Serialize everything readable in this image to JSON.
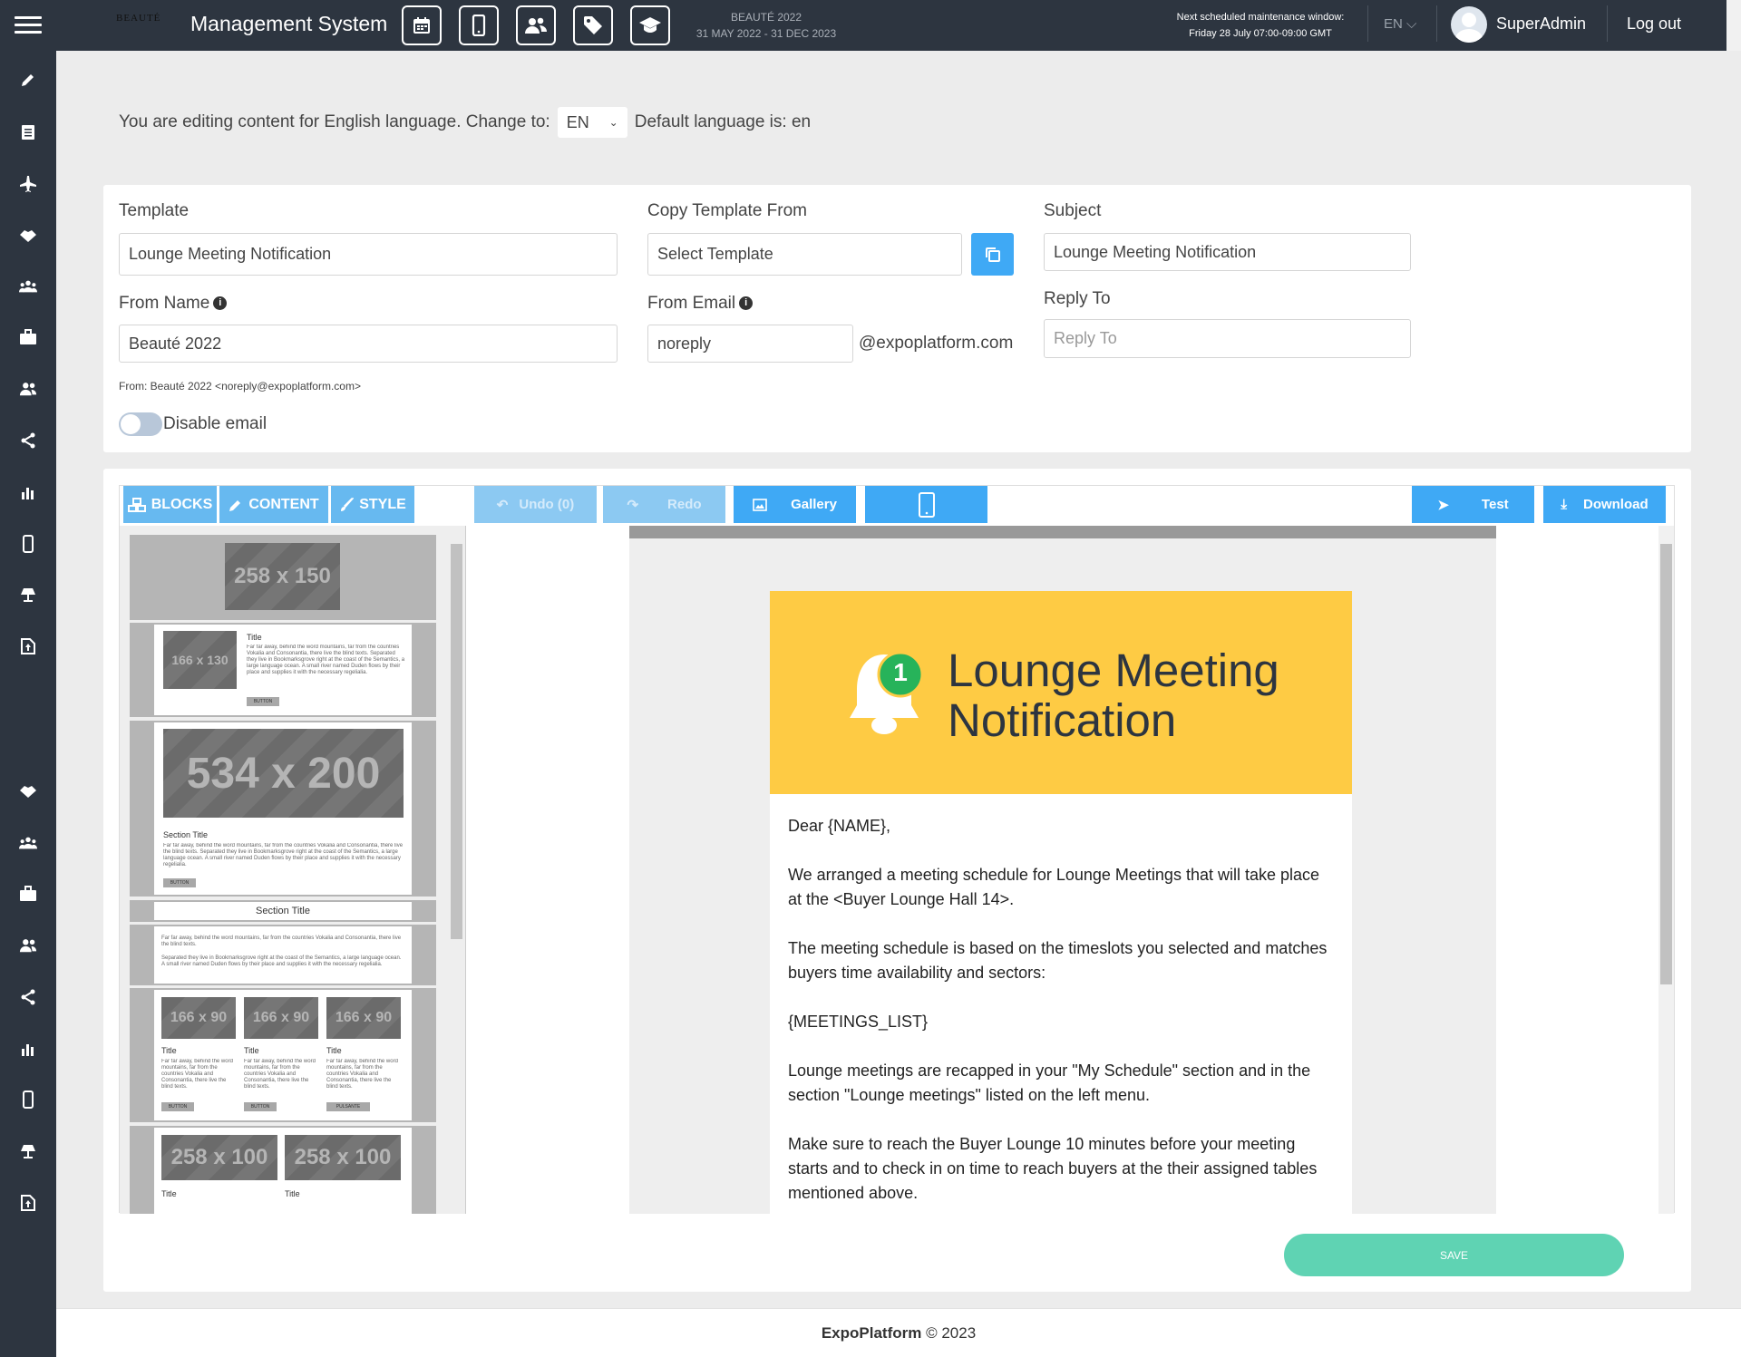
{
  "header": {
    "app_title": "Management System",
    "brand_logo": "BEAUTÉ",
    "event_name": "BEAUTÉ 2022",
    "event_dates": "31 MAY 2022 - 31 DEC 2023",
    "maintenance_title": "Next scheduled maintenance window:",
    "maintenance_time": "Friday 28 July 07:00-09:00 GMT",
    "language": "EN",
    "username": "SuperAdmin",
    "logout": "Log out",
    "icons": [
      "calendar-icon",
      "mobile-icon",
      "users-icon",
      "tag-icon",
      "graduation-cap-icon"
    ]
  },
  "sidebar": {
    "icons": [
      "pencil-icon",
      "list-icon",
      "plane-icon",
      "handshake-icon",
      "group-icon",
      "briefcase-icon",
      "users-icon",
      "share-icon",
      "bar-chart-icon",
      "mobile-icon",
      "lamp-icon",
      "upload-icon",
      "handshake-icon",
      "group-icon",
      "briefcase-icon",
      "users-icon",
      "share-icon",
      "bar-chart-icon",
      "mobile-icon",
      "lamp-icon",
      "upload-icon"
    ]
  },
  "language_bar": {
    "prefix": "You are editing content for English language. Change to:",
    "selected": "EN",
    "default_text": "Default language is: en"
  },
  "form": {
    "template_label": "Template",
    "template_value": "Lounge Meeting Notification",
    "copy_label": "Copy Template From",
    "copy_placeholder": "Select Template",
    "subject_label": "Subject",
    "subject_value": "Lounge Meeting Notification",
    "from_name_label": "From Name",
    "from_name_value": "Beauté 2022",
    "from_email_label": "From Email",
    "from_email_value": "noreply",
    "from_email_domain": "@expoplatform.com",
    "reply_to_label": "Reply To",
    "reply_to_placeholder": "Reply To",
    "from_preview": "From: Beauté 2022 <noreply@expoplatform.com>",
    "disable_email_label": "Disable email",
    "disable_email_on": false
  },
  "editor": {
    "tabs": [
      "BLOCKS",
      "CONTENT",
      "STYLE"
    ],
    "undo": "Undo (0)",
    "redo": "Redo",
    "gallery": "Gallery",
    "test": "Test",
    "download": "Download",
    "blocks": {
      "b1_img": "258 x 150",
      "b2_img": "166 x 130",
      "title": "Title",
      "lorem": "Far far away, behind the word mountains, far from the countries Vokalia and Consonantia, there live the blind texts. Separated they live in Bookmarksgrove right at the coast of the Semantics, a large language ocean. A small river named Duden flows by their place and supplies it with the necessary regelialia.",
      "lorem_short": "Far far away, behind the word mountains, far from the countries Vokalia and Consonantia, there live the blind texts.",
      "lorem_short2": "Separated they live in Bookmarksgrove right at the coast of the Semantics, a large language ocean. A small river named Duden flows by their place and supplies it with the necessary regelialia.",
      "button": "BUTTON",
      "button_alt": "PULSANTE",
      "b3_img": "534 x 200",
      "section_title": "Section Title",
      "b6_img": "166 x 90",
      "b7_img": "258 x 100"
    },
    "email": {
      "badge": "1",
      "title_line1": "Lounge Meeting",
      "title_line2": "Notification",
      "paragraphs": [
        "Dear {NAME},",
        "We arranged a meeting schedule for Lounge Meetings that will take place at the <Buyer Lounge Hall 14>.",
        "The meeting schedule is based on the timeslots you selected and matches buyers time availability and sectors:",
        "{MEETINGS_LIST}",
        "Lounge meetings are recapped in your \"My Schedule\" section and in the section \"Lounge meetings\" listed on the left menu.",
        "Make sure to reach the Buyer Lounge 10 minutes before your meeting starts and to check in on time to reach buyers at the their assigned tables mentioned above."
      ]
    }
  },
  "save_label": "SAVE",
  "footer": {
    "brand": "ExpoPlatform",
    "copyright": "© 2023"
  },
  "colors": {
    "topbar": "#2d3540",
    "accent": "#3fa9f5",
    "save": "#5fd3b3",
    "email_header": "#fecb44"
  }
}
